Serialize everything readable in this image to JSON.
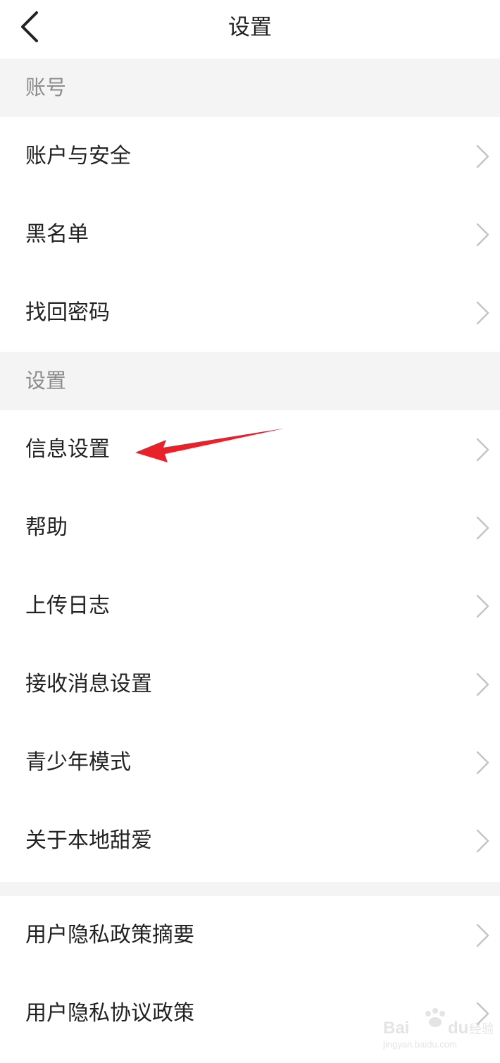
{
  "header": {
    "title": "设置",
    "back_icon": "chevron-left-icon"
  },
  "sections": [
    {
      "header": "账号",
      "items": [
        {
          "label": "账户与安全",
          "icon": "chevron-right-icon"
        },
        {
          "label": "黑名单",
          "icon": "chevron-right-icon"
        },
        {
          "label": "找回密码",
          "icon": "chevron-right-icon"
        }
      ]
    },
    {
      "header": "设置",
      "items": [
        {
          "label": "信息设置",
          "icon": "chevron-right-icon"
        },
        {
          "label": "帮助",
          "icon": "chevron-right-icon"
        },
        {
          "label": "上传日志",
          "icon": "chevron-right-icon"
        },
        {
          "label": "接收消息设置",
          "icon": "chevron-right-icon"
        },
        {
          "label": "青少年模式",
          "icon": "chevron-right-icon"
        },
        {
          "label": "关于本地甜爱",
          "icon": "chevron-right-icon"
        }
      ]
    },
    {
      "header": "",
      "items": [
        {
          "label": "用户隐私政策摘要",
          "icon": "chevron-right-icon"
        },
        {
          "label": "用户隐私协议政策",
          "icon": "chevron-right-icon"
        }
      ]
    }
  ],
  "annotation": {
    "color": "#e8212b",
    "points_to": "信息设置"
  },
  "colors": {
    "section_background": "#f4f4f4",
    "section_text": "#8c8c8c",
    "row_text": "#222222",
    "chevron": "#c4c4c4"
  },
  "watermark": {
    "brand": "Bai du 经验",
    "url": "jingyan.baidu.com"
  }
}
